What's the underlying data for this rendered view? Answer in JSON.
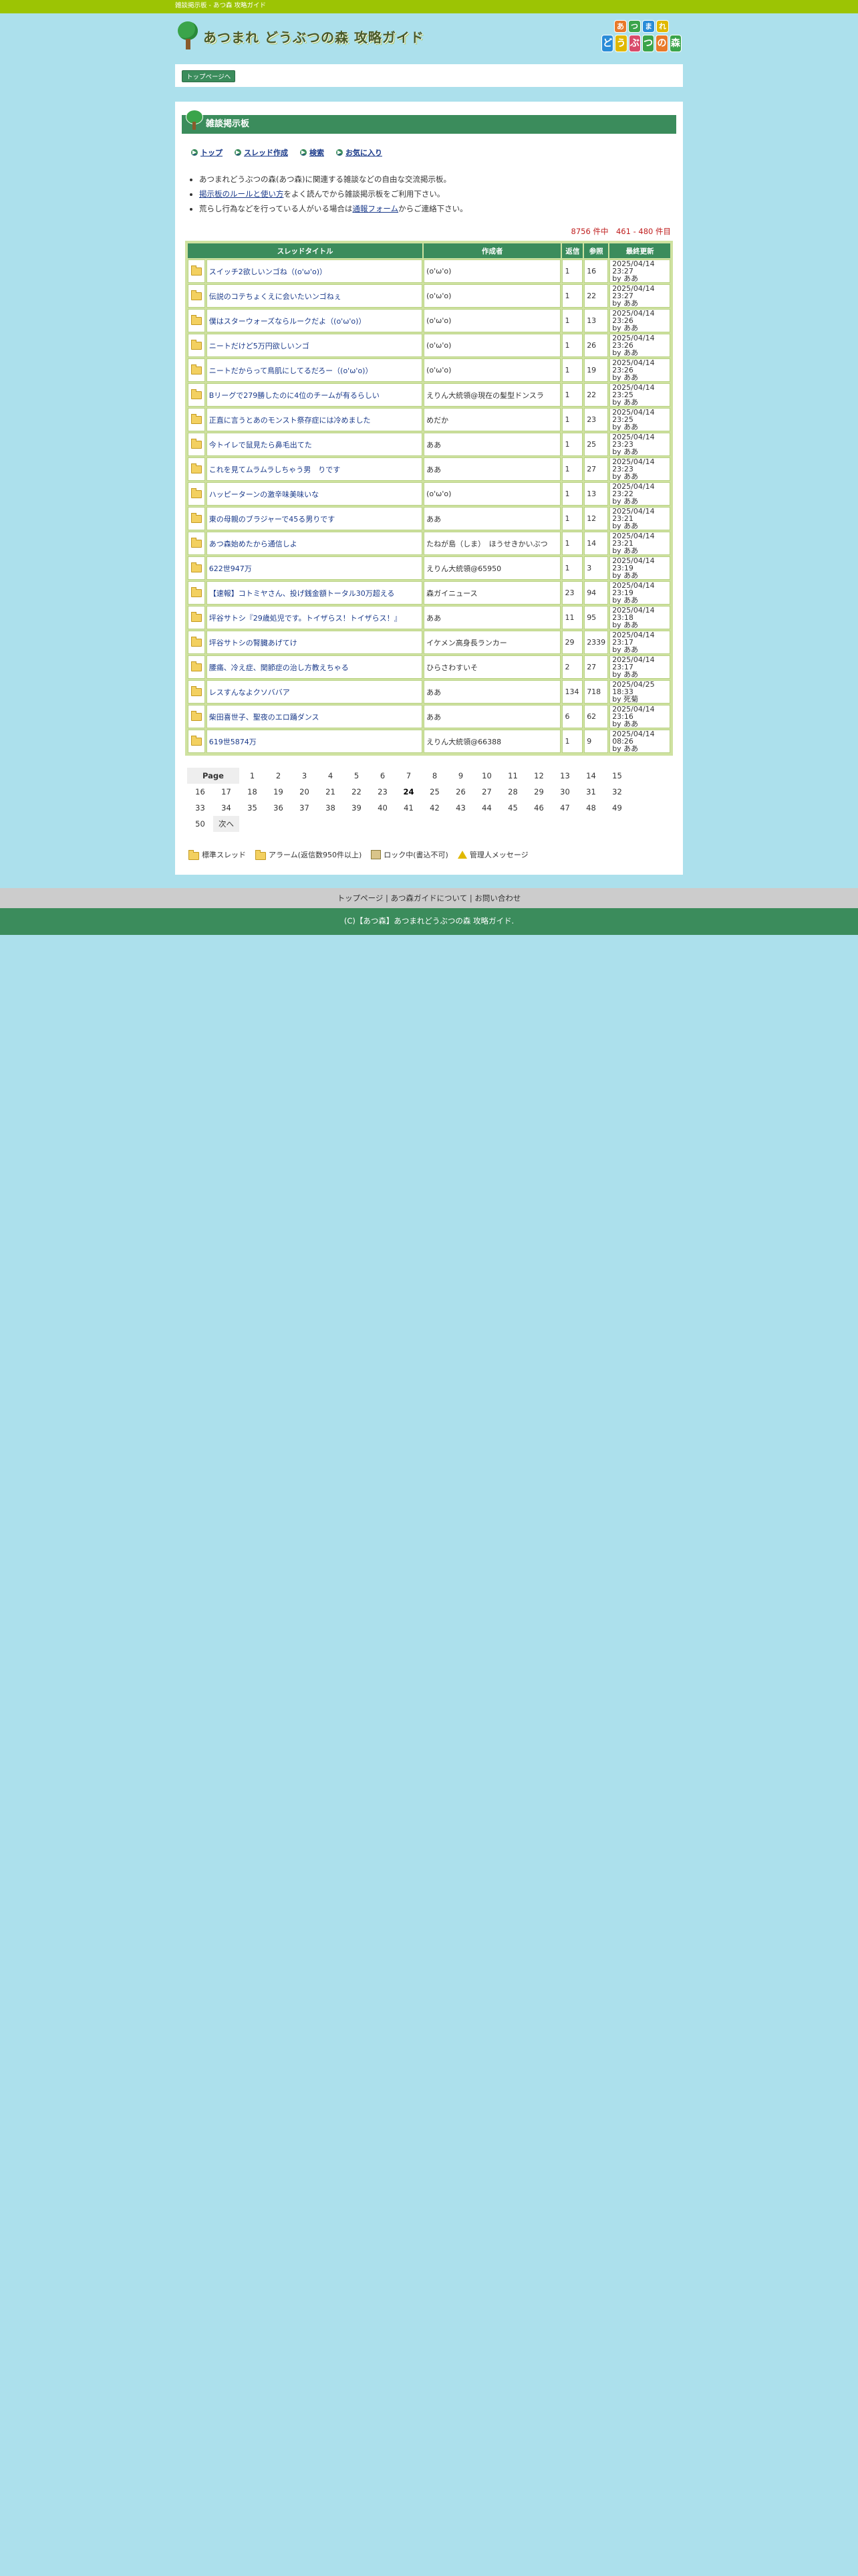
{
  "topbar": {
    "text": "雑談掲示板 - あつ森 攻略ガイド"
  },
  "header": {
    "site_title": "あつまれ どうぶつの森 攻略ガイド",
    "logo_line1": [
      "あ",
      "つ",
      "ま",
      "れ"
    ],
    "logo_line2": [
      "ど",
      "う",
      "ぶ",
      "つ",
      "の",
      "森"
    ],
    "logo_colors": [
      "#e8792a",
      "#3aa44a",
      "#2a8cd8",
      "#e0b800",
      "#d84a6a",
      "#3aa44a"
    ]
  },
  "breadcrumb": {
    "label": "トップページへ"
  },
  "board": {
    "title": "雑談掲示板",
    "nav": [
      {
        "label": "トップ",
        "icon": "arrow-icon"
      },
      {
        "label": "スレッド作成",
        "icon": "arrow-icon"
      },
      {
        "label": "検索",
        "icon": "arrow-icon"
      },
      {
        "label": "お気に入り",
        "icon": "arrow-icon"
      }
    ],
    "notes": {
      "n1": "あつまれどうぶつの森(あつ森)に関連する雑談などの自由な交流掲示板。",
      "n2_link": "掲示板のルールと使い方",
      "n2_rest": "をよく読んでから雑談掲示板をご利用下さい。",
      "n3_pre": "荒らし行為などを行っている人がいる場合は",
      "n3_link": "通報フォーム",
      "n3_post": "からご連絡下さい。"
    },
    "count_text": "8756 件中　461 - 480 件目"
  },
  "table": {
    "headers": {
      "title": "スレッドタイトル",
      "author": "作成者",
      "replies": "返信",
      "views": "参照",
      "updated": "最終更新"
    },
    "rows": [
      {
        "title": "スイッチ2欲しいンゴね（(o'ω'o)）",
        "author": "(o'ω'o)",
        "replies": "1",
        "views": "16",
        "date": "2025/04/14 23:27",
        "by": "by ああ"
      },
      {
        "title": "伝説のコテちょくえに会いたいンゴねぇ",
        "author": "(o'ω'o)",
        "replies": "1",
        "views": "22",
        "date": "2025/04/14 23:27",
        "by": "by ああ"
      },
      {
        "title": "僕はスターウォーズならルークだよ（(o'ω'o)）",
        "author": "(o'ω'o)",
        "replies": "1",
        "views": "13",
        "date": "2025/04/14 23:26",
        "by": "by ああ"
      },
      {
        "title": "ニートだけど5万円欲しいンゴ",
        "author": "(o'ω'o)",
        "replies": "1",
        "views": "26",
        "date": "2025/04/14 23:26",
        "by": "by ああ"
      },
      {
        "title": "ニートだからって鳥肌にしてるだろー（(o'ω'o)）",
        "author": "(o'ω'o)",
        "replies": "1",
        "views": "19",
        "date": "2025/04/14 23:26",
        "by": "by ああ"
      },
      {
        "title": "Bリーグで279勝したのに4位のチームが有るらしい",
        "author": "えりん大統領@現在の髪型ドンスラ",
        "replies": "1",
        "views": "22",
        "date": "2025/04/14 23:25",
        "by": "by ああ"
      },
      {
        "title": "正直に言うとあのモンスト祭存症には冷めました",
        "author": "めだか",
        "replies": "1",
        "views": "23",
        "date": "2025/04/14 23:25",
        "by": "by ああ"
      },
      {
        "title": "今トイレで鼠見たら鼻毛出てた",
        "author": "ああ",
        "replies": "1",
        "views": "25",
        "date": "2025/04/14 23:23",
        "by": "by ああ"
      },
      {
        "title": "これを見てムラムラしちゃう男　りです",
        "author": "ああ",
        "replies": "1",
        "views": "27",
        "date": "2025/04/14 23:23",
        "by": "by ああ"
      },
      {
        "title": "ハッピーターンの激辛味美味いな",
        "author": "(o'ω'o)",
        "replies": "1",
        "views": "13",
        "date": "2025/04/14 23:22",
        "by": "by ああ"
      },
      {
        "title": "東の母親のブラジャーで45る男りです",
        "author": "ああ",
        "replies": "1",
        "views": "12",
        "date": "2025/04/14 23:21",
        "by": "by ああ"
      },
      {
        "title": "あつ森始めたから通信しよ",
        "author": "たねが島（しま）　ほうせきかいぶつ",
        "replies": "1",
        "views": "14",
        "date": "2025/04/14 23:21",
        "by": "by ああ"
      },
      {
        "title": "622世947万",
        "author": "えりん大統領@65950",
        "replies": "1",
        "views": "3",
        "date": "2025/04/14 23:19",
        "by": "by ああ"
      },
      {
        "title": "【速報】コトミヤさん、投げ銭金額トータル30万超える",
        "author": "森ガイニュース",
        "replies": "23",
        "views": "94",
        "date": "2025/04/14 23:19",
        "by": "by ああ"
      },
      {
        "title": "坪谷サトシ『29歳処児です。トイザらス！トイザらス！』",
        "author": "ああ",
        "replies": "11",
        "views": "95",
        "date": "2025/04/14 23:18",
        "by": "by ああ"
      },
      {
        "title": "坪谷サトシの腎臓あげてけ",
        "author": "イケメン高身長ランカー",
        "replies": "29",
        "views": "2339",
        "date": "2025/04/14 23:17",
        "by": "by ああ"
      },
      {
        "title": "腰痛、冷え症、関節症の治し方教えちゃる",
        "author": "ひらさわすいそ",
        "replies": "2",
        "views": "27",
        "date": "2025/04/14 23:17",
        "by": "by ああ"
      },
      {
        "title": "レスすんなよクソババア",
        "author": "ああ",
        "replies": "134",
        "views": "718",
        "date": "2025/04/25 18:33",
        "by": "by 死菊"
      },
      {
        "title": "柴田喜世子、聖夜のエロ踊ダンス",
        "author": "ああ",
        "replies": "6",
        "views": "62",
        "date": "2025/04/14 23:16",
        "by": "by ああ"
      },
      {
        "title": "619世5874万",
        "author": "えりん大統領@66388",
        "replies": "1",
        "views": "9",
        "date": "2025/04/14 08:26",
        "by": "by ああ"
      }
    ]
  },
  "pager": {
    "label": "Page",
    "pages": [
      "1",
      "2",
      "3",
      "4",
      "5",
      "6",
      "7",
      "8",
      "9",
      "10",
      "11",
      "12",
      "13",
      "14",
      "15",
      "16",
      "17",
      "18",
      "19",
      "20",
      "21",
      "22",
      "23",
      "24",
      "25",
      "26",
      "27",
      "28",
      "29",
      "30",
      "31",
      "32",
      "33",
      "34",
      "35",
      "36",
      "37",
      "38",
      "39",
      "40",
      "41",
      "42",
      "43",
      "44",
      "45",
      "46",
      "47",
      "48",
      "49",
      "50"
    ],
    "current": "24",
    "next": "次へ"
  },
  "legend": {
    "standard": "標準スレッド",
    "alarm": "アラーム(返信数950件以上)",
    "locked": "ロック中(書込不可)",
    "admin": "管理人メッセージ"
  },
  "footer": {
    "links": [
      "トップページ",
      "あつ森ガイドについて",
      "お問い合わせ"
    ],
    "separator": "|",
    "copyright": "(C)【あつ森】あつまれどうぶつの森 攻略ガイド."
  }
}
